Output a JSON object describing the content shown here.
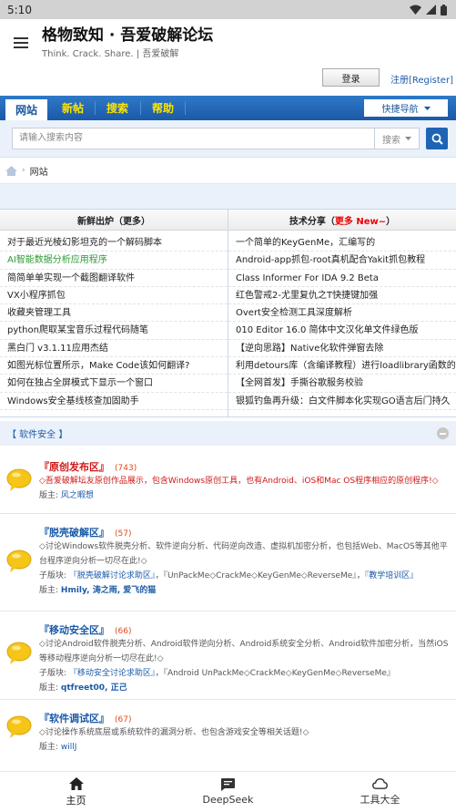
{
  "status_bar": {
    "time": "5:10"
  },
  "app": {
    "title": "格物致知 · 吾爱破解论坛",
    "subtitle": "Think. Crack. Share. | 吾爱破解"
  },
  "auth": {
    "login": "登录",
    "register": "注册[Register]"
  },
  "nav": {
    "tabs": [
      "网站",
      "新帖",
      "搜索",
      "帮助"
    ],
    "quick_nav": "快捷导航"
  },
  "search": {
    "placeholder": "请输入搜索内容",
    "scope": "搜索"
  },
  "breadcrumb": {
    "current": "网站"
  },
  "columns": {
    "left": {
      "title": "新鲜出炉（更多）",
      "items": [
        "对于最近光棱幻影坦克的一个解码脚本",
        "AI智能数据分析应用程序",
        "简简单单实现一个截图翻译软件",
        "VX小程序抓包",
        "收藏夹管理工具",
        "python爬取某宝音乐过程代码随笔",
        "黑白门 v3.1.11应用杰结",
        "如图光标位置所示，Make Code该如何翻译?",
        "如何在独占全屏模式下显示一个窗口",
        "Windows安全基线核查加固助手"
      ]
    },
    "right": {
      "title": "技术分享（",
      "title_red": "更多 New~",
      "title_end": "）",
      "items": [
        "一个简单的KeyGenMe，汇编写的",
        "Android-app抓包-root真机配合Yakit抓包教程",
        "Class Informer For IDA 9.2 Beta",
        "红色警戒2-尤里复仇之T快捷键加强",
        "Overt安全检测工具深度解析",
        "010 Editor 16.0 简体中文汉化单文件绿色版",
        "【逆向思路】Native化软件弹窗去除",
        "利用detours库（含编译教程）进行loadlibrary函数的h",
        "【全网首发】手撕谷歌服务校验",
        "银狐钓鱼再升级：白文件脚本化实现GO语言后门持久"
      ]
    }
  },
  "section": {
    "title": "【 软件安全 】"
  },
  "forums": [
    {
      "name": "『原创发布区』",
      "count": "(743)",
      "desc": "◇吾爱破解坛友原创作品展示，包含Windows原创工具，也有Android、iOS和Mac OS程序相应的原创程序!◇",
      "moderator_label": "版主:",
      "moderators": "风之暇想"
    },
    {
      "name": "『脱壳破解区』",
      "count": "(57)",
      "desc": "◇讨论Windows软件脱壳分析、软件逆向分析、代码逆向改造、虚拟机加密分析，也包括Web、MacOS等其他平台程序逆向分析一切尽在此!◇",
      "sub_label": "子版块:",
      "sub_a": "『脱壳破解讨论求助区』",
      "sub_b": "，『UnPackMe◇CrackMe◇KeyGenMe◇ReverseMe』，",
      "sub_c": "『教学培训区』",
      "moderator_label": "版主:",
      "moderators": "Hmily, 涛之雨, 爱飞的猫"
    },
    {
      "name": "『移动安全区』",
      "count": "(66)",
      "desc": "◇讨论Android软件脱壳分析、Android软件逆向分析、Android系统安全分析、Android软件加密分析，当然iOS等移动程序逆向分析一切尽在此!◇",
      "sub_label": "子版块:",
      "sub_a": "『移动安全讨论求助区』",
      "sub_b": "，『Android UnPackMe◇CrackMe◇KeyGenMe◇ReverseMe』",
      "moderator_label": "版主:",
      "moderators": "qtfreet00, 正己"
    },
    {
      "name": "『软件调试区』",
      "count": "(67)",
      "desc": "◇讨论操作系统底层或系统软件的漏洞分析、也包含游戏安全等相关话题!◇",
      "moderator_label": "版主:",
      "moderators": "willJ"
    }
  ],
  "bottom_nav": [
    {
      "label": "主页",
      "icon": "home-icon"
    },
    {
      "label": "DeepSeek",
      "icon": "chat-icon"
    },
    {
      "label": "工具大全",
      "icon": "cloud-icon"
    }
  ]
}
